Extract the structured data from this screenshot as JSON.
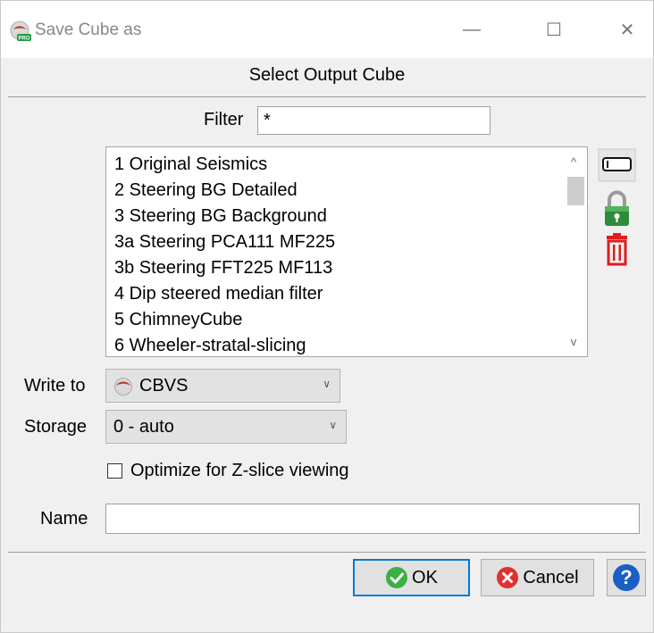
{
  "window": {
    "title": "Save Cube as",
    "minimize_glyph": "—",
    "maximize_glyph": "☐",
    "close_glyph": "✕"
  },
  "heading": "Select Output Cube",
  "filter": {
    "label": "Filter",
    "value": "*"
  },
  "cube_list": {
    "items": [
      "1 Original Seismics",
      "2 Steering BG Detailed",
      "3 Steering BG Background",
      "3a Steering PCA111 MF225",
      "3b Steering FFT225 MF113",
      "4 Dip steered median filter",
      "5 ChimneyCube",
      "6 Wheeler-stratal-slicing"
    ],
    "scroll_up_glyph": "^",
    "scroll_down_glyph": "v"
  },
  "side_buttons": [
    "rename-icon",
    "lock-icon",
    "trash-icon"
  ],
  "write_to": {
    "label": "Write to",
    "value": "CBVS",
    "icon": "cbvs-icon"
  },
  "storage": {
    "label": "Storage",
    "value": "0 - auto"
  },
  "optimize": {
    "label": "Optimize for Z-slice viewing",
    "checked": false
  },
  "name": {
    "label": "Name",
    "value": ""
  },
  "buttons": {
    "ok": "OK",
    "cancel": "Cancel",
    "help_glyph": "?"
  },
  "colors": {
    "ok_green": "#3cb043",
    "cancel_red": "#e03030",
    "help_blue": "#1a5fc4",
    "trash_red": "#e21b1b",
    "lock_green": "#2e8b3a"
  }
}
